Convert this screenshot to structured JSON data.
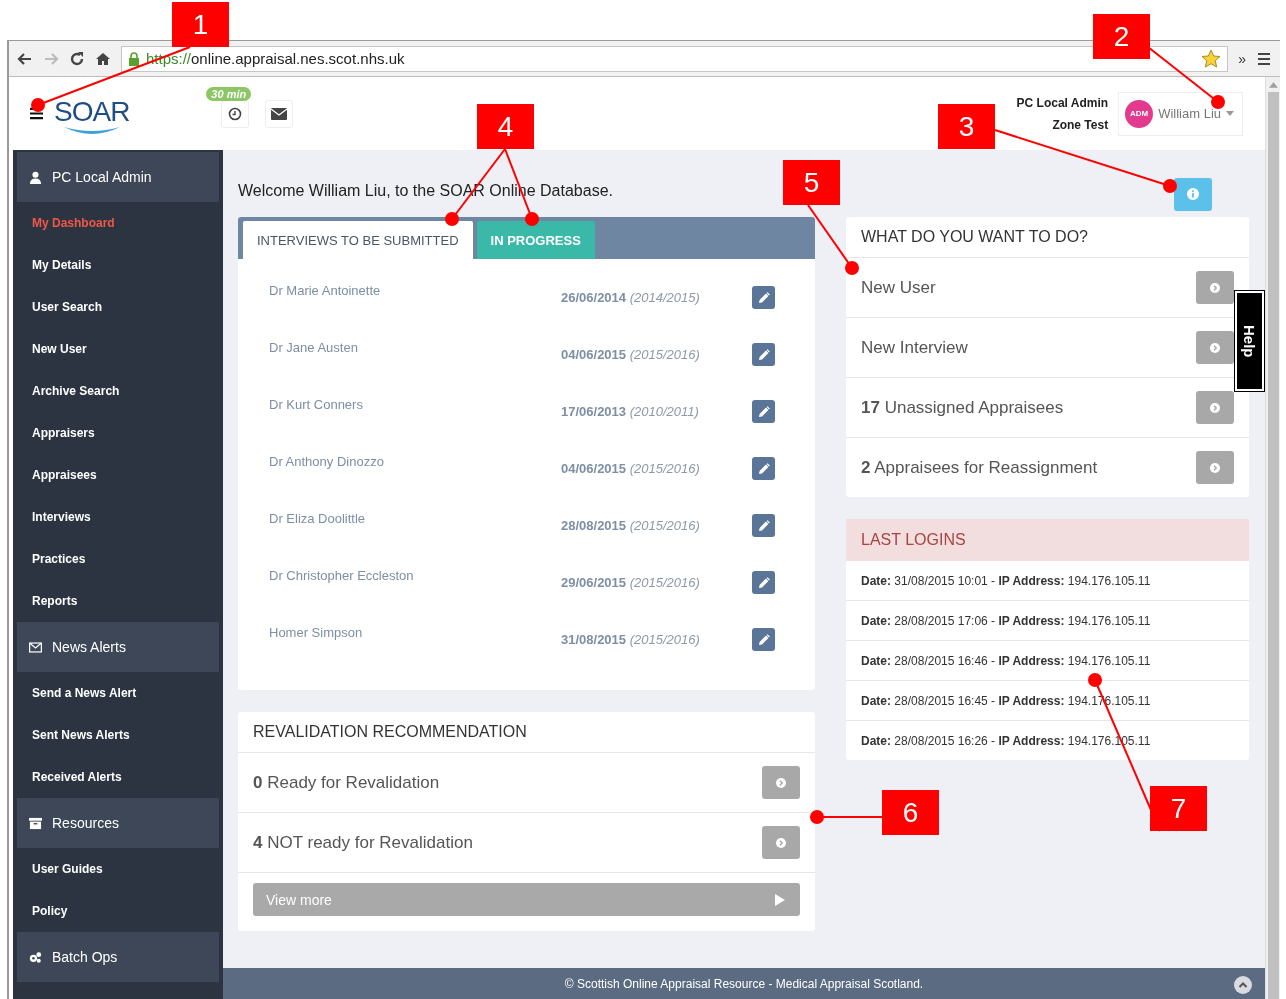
{
  "browser": {
    "url_scheme": "https://",
    "url_host": "online.appraisal.nes.scot.nhs.uk",
    "right_button": "»"
  },
  "header": {
    "logo": "SOAR",
    "timer_badge": "30 min",
    "role": "PC Local Admin",
    "zone": "Zone Test",
    "avatar": "ADM",
    "user_name": "William Liu"
  },
  "sidebar": [
    {
      "kind": "section",
      "label": "PC Local Admin",
      "items": [
        {
          "label": "My Dashboard",
          "selected": true
        },
        {
          "label": "My Details",
          "selected": false
        },
        {
          "label": "User Search",
          "selected": false
        },
        {
          "label": "New User",
          "selected": false
        },
        {
          "label": "Archive Search",
          "selected": false
        },
        {
          "label": "Appraisers",
          "selected": false
        },
        {
          "label": "Appraisees",
          "selected": false
        },
        {
          "label": "Interviews",
          "selected": false
        },
        {
          "label": "Practices",
          "selected": false
        },
        {
          "label": "Reports",
          "selected": false
        }
      ]
    },
    {
      "kind": "section",
      "label": "News Alerts",
      "items": [
        {
          "label": "Send a News Alert",
          "selected": false
        },
        {
          "label": "Sent News Alerts",
          "selected": false
        },
        {
          "label": "Received Alerts",
          "selected": false
        }
      ]
    },
    {
      "kind": "section",
      "label": "Resources",
      "items": [
        {
          "label": "User Guides",
          "selected": false
        },
        {
          "label": "Policy",
          "selected": false
        }
      ]
    },
    {
      "kind": "section",
      "label": "Batch Ops"
    }
  ],
  "welcome": "Welcome William Liu, to the SOAR Online Database.",
  "tabs": [
    {
      "label": "INTERVIEWS TO BE SUBMITTED",
      "selected": true
    },
    {
      "label": "IN PROGRESS",
      "selected": false
    }
  ],
  "interviews": [
    {
      "name": "Dr Marie Antoinette",
      "date": "26/06/2014",
      "period": "(2014/2015)"
    },
    {
      "name": "Dr Jane Austen",
      "date": "04/06/2015",
      "period": "(2015/2016)"
    },
    {
      "name": "Dr Kurt Conners",
      "date": "17/06/2013",
      "period": "(2010/2011)"
    },
    {
      "name": "Dr Anthony Dinozzo",
      "date": "04/06/2015",
      "period": "(2015/2016)"
    },
    {
      "name": "Dr Eliza Doolittle",
      "date": "28/08/2015",
      "period": "(2015/2016)"
    },
    {
      "name": "Dr Christopher Eccleston",
      "date": "29/06/2015",
      "period": "(2015/2016)"
    },
    {
      "name": "Homer Simpson",
      "date": "31/08/2015",
      "period": "(2015/2016)"
    }
  ],
  "revalidation": {
    "title": "REVALIDATION RECOMMENDATION",
    "rows": [
      "**0** Ready for Revalidation",
      "**4** NOT ready for Revalidation"
    ],
    "view_more": "View more"
  },
  "actions": {
    "title": "WHAT DO YOU WANT TO DO?",
    "rows": [
      "New User",
      "New Interview",
      "**17** Unassigned Appraisees",
      "**2** Appraisees for Reassignment"
    ]
  },
  "logins": {
    "title": "LAST LOGINS",
    "rows": [
      "**Date:** 31/08/2015 10:01 - **IP Address:** 194.176.105.11",
      "**Date:** 28/08/2015 17:06 - **IP Address:** 194.176.105.11",
      "**Date:** 28/08/2015 16:46 - **IP Address:** 194.176.105.11",
      "**Date:** 28/08/2015 16:45 - **IP Address:** 194.176.105.11",
      "**Date:** 28/08/2015 16:26 - **IP Address:** 194.176.105.11"
    ]
  },
  "help_tab": "Help",
  "footer": "© Scottish Online Appraisal Resource - Medical Appraisal Scotland.",
  "callouts": [
    "1",
    "2",
    "3",
    "4",
    "5",
    "6",
    "7"
  ]
}
